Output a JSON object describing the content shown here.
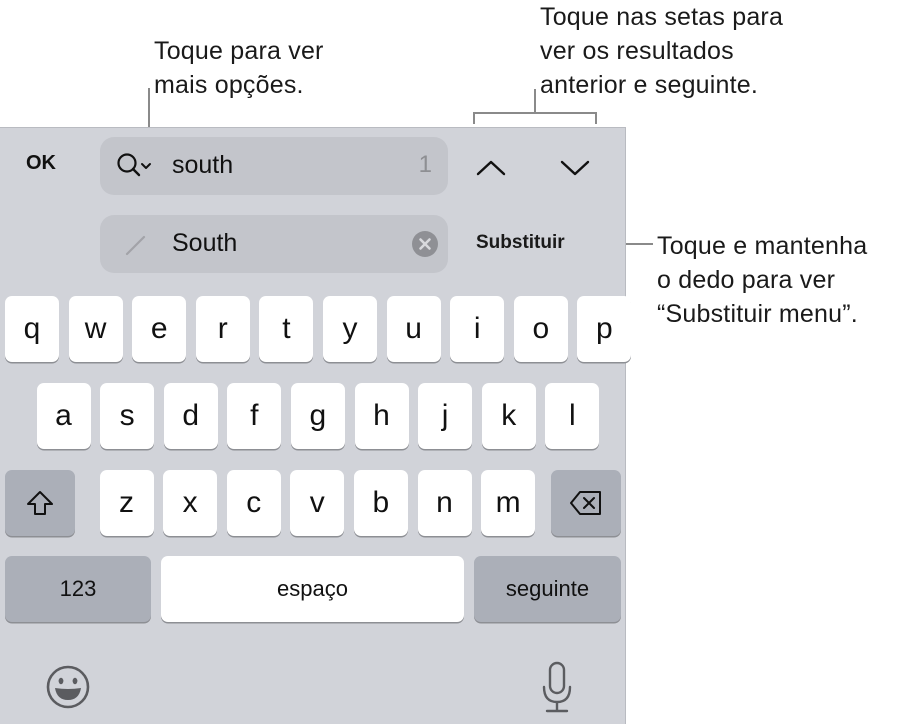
{
  "callouts": {
    "more_options": "Toque para ver\nmais opções.",
    "arrows": "Toque nas setas para\nver os resultados\nanterior e seguinte.",
    "replace_menu": "Toque e mantenha\no dedo para ver\n“Substituir menu”."
  },
  "toolbar": {
    "ok_label": "OK",
    "find": {
      "value": "south",
      "match_count": "1",
      "icon": "search-options-icon"
    },
    "replace": {
      "value": "South",
      "icon": "pencil-icon",
      "clear_icon": "clear-icon"
    },
    "prev_icon": "chevron-up-icon",
    "next_icon": "chevron-down-icon",
    "replace_label": "Substituir"
  },
  "keyboard": {
    "row1": [
      "q",
      "w",
      "e",
      "r",
      "t",
      "y",
      "u",
      "i",
      "o",
      "p"
    ],
    "row2": [
      "a",
      "s",
      "d",
      "f",
      "g",
      "h",
      "j",
      "k",
      "l"
    ],
    "row3": [
      "z",
      "x",
      "c",
      "v",
      "b",
      "n",
      "m"
    ],
    "shift_icon": "shift-icon",
    "delete_icon": "delete-icon",
    "numbers_label": "123",
    "space_label": "espaço",
    "return_label": "seguinte",
    "emoji_icon": "emoji-icon",
    "mic_icon": "microphone-icon"
  },
  "colors": {
    "panel_bg": "#d1d3d9",
    "field_bg": "#c3c5cb",
    "key_bg": "#ffffff",
    "func_key_bg": "#abafb8"
  }
}
